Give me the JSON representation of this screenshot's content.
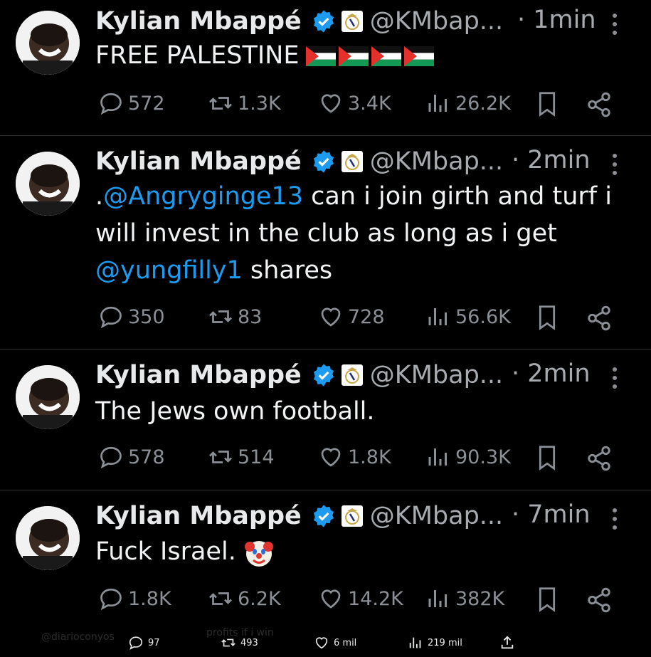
{
  "tweets": [
    {
      "author": "Kylian Mbappé",
      "handle": "@KMbap...",
      "time": "· 1min",
      "text": "FREE PALESTINE",
      "replies": "572",
      "reposts": "1.3K",
      "likes": "3.4K",
      "views": "26.2K"
    },
    {
      "author": "Kylian Mbappé",
      "handle": "@KMbap...",
      "time": "· 2min",
      "text_parts": [
        ".",
        "@Angryginge13",
        " can i join girth and turf i will invest in the club as long as i get ",
        "@yungfilly1",
        " shares"
      ],
      "replies": "350",
      "reposts": "83",
      "likes": "728",
      "views": "56.6K"
    },
    {
      "author": "Kylian Mbappé",
      "handle": "@KMbap...",
      "time": "· 2min",
      "text": "The Jews own football.",
      "replies": "578",
      "reposts": "514",
      "likes": "1.8K",
      "views": "90.3K"
    },
    {
      "author": "Kylian Mbappé",
      "handle": "@KMbap...",
      "time": "· 7min",
      "text": "Fuck Israel.",
      "replies": "1.8K",
      "reposts": "6.2K",
      "likes": "14.2K",
      "views": "382K"
    }
  ],
  "bottom_bar": {
    "ghost_handle": "@diarioconyos",
    "ghost_text": "profits if i win",
    "replies": "97",
    "reposts": "493",
    "likes": "6 mil",
    "views": "219 mil"
  },
  "colors": {
    "accent": "#1d9bf0",
    "muted": "#8b9096",
    "text": "#e7e9ea",
    "background": "#000000"
  },
  "icons": [
    "verified-badge-icon",
    "real-madrid-crest-icon",
    "more-icon",
    "reply-icon",
    "repost-icon",
    "like-icon",
    "views-icon",
    "bookmark-icon",
    "share-icon",
    "palestine-flag-icon",
    "clown-face-icon",
    "upload-icon"
  ]
}
